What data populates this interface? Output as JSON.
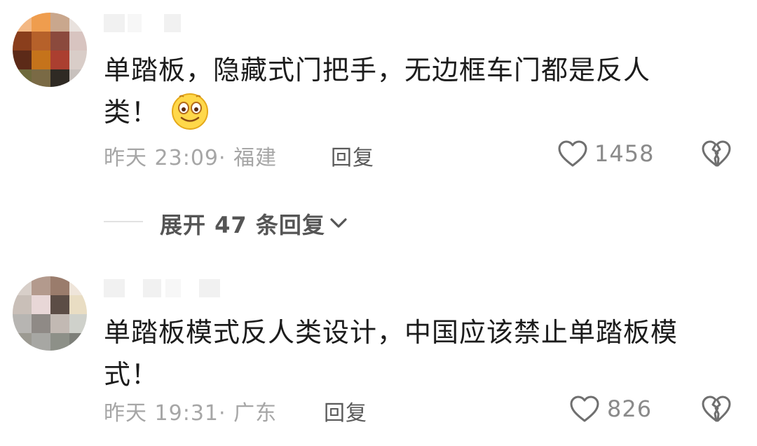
{
  "comments": [
    {
      "text_line1": "单踏板，隐藏式门把手，无边框车门都是反人",
      "text_line2": "类！",
      "emoji": "smiling-face-emoji",
      "time_location": "昨天 23:09· 福建",
      "reply_label": "回复",
      "likes": "1458",
      "expand_label": "展开 47 条回复"
    },
    {
      "text_line1": "单踏板模式反人类设计，中国应该禁止单踏板模",
      "text_line2": "式！",
      "time_location": "昨天 19:31· 广东",
      "reply_label": "回复",
      "likes": "826"
    }
  ],
  "icons": {
    "like": "heart-outline-icon",
    "dislike": "broken-heart-icon",
    "expand": "chevron-down-icon"
  },
  "colors": {
    "text": "#1c1c1c",
    "meta": "#a6a6a6",
    "icon": "#6f6f6f"
  }
}
